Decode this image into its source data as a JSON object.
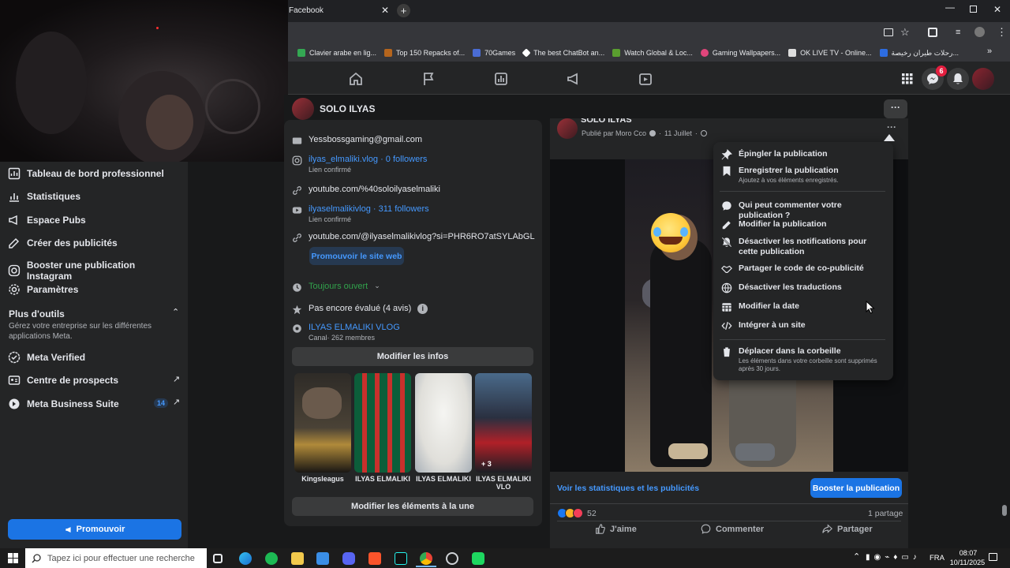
{
  "browser": {
    "tab_title": "Facebook",
    "bookmarks": [
      {
        "label": "Clavier arabe en lig...",
        "color": "#34a853"
      },
      {
        "label": "Top 150 Repacks of...",
        "color": "#b5651d"
      },
      {
        "label": "70Games",
        "color": "#4a6cd4"
      },
      {
        "label": "The best ChatBot an...",
        "color": "#ffffff"
      },
      {
        "label": "Watch Global & Loc...",
        "color": "#5a9e2f"
      },
      {
        "label": "Gaming Wallpapers...",
        "color": "#e0457b"
      },
      {
        "label": "OK LIVE TV - Online...",
        "color": "#dddddd"
      },
      {
        "label": "رحلات طيران رخيصة...",
        "color": "#2d6ce0"
      }
    ]
  },
  "header": {
    "notification_badge": "6"
  },
  "page": {
    "name": "SOLO ILYAS"
  },
  "sidebar": {
    "items": [
      {
        "label": "Tableau de bord professionnel",
        "icon": "dashboard-icon"
      },
      {
        "label": "Statistiques",
        "icon": "chart-icon"
      },
      {
        "label": "Espace Pubs",
        "icon": "megaphone-icon"
      },
      {
        "label": "Créer des publicités",
        "icon": "edit-icon"
      },
      {
        "label": "Booster une publication Instagram",
        "icon": "instagram-icon"
      },
      {
        "label": "Paramètres",
        "icon": "gear-icon"
      }
    ],
    "more_tools_title": "Plus d'outils",
    "more_tools_desc": "Gérez votre entreprise sur les différentes applications Meta.",
    "tools": [
      {
        "label": "Meta Verified",
        "icon": "verified-icon"
      },
      {
        "label": "Centre de prospects",
        "icon": "prospects-icon"
      },
      {
        "label": "Meta Business Suite",
        "icon": "business-suite-icon",
        "badge": "14"
      }
    ],
    "promote_label": "Promouvoir"
  },
  "intro": {
    "email": "Yessbossgaming@gmail.com",
    "instagram": "ilyas_elmaliki.vlog · 0 followers",
    "instagram_sub": "Lien confirmé",
    "youtube_url": "youtube.com/%40soloilyaselmaliki",
    "youtube_channel": "ilyaselmalikivlog · 311 followers",
    "youtube_sub": "Lien confirmé",
    "youtube_url2": "youtube.com/@ilyaselmalikivlog?si=PHR6RO7atSYLAbGL",
    "promote_site": "Promouvoir le site web",
    "hours": "Toujours ouvert",
    "rating": "Pas encore évalué (4 avis)",
    "channel_name": "ILYAS ELMALIKI VLOG",
    "channel_sub": "Canal· 262 membres",
    "edit_info": "Modifier les infos",
    "featured": [
      {
        "label": "Kingsleagus"
      },
      {
        "label": "ILYAS ELMALIKI"
      },
      {
        "label": "ILYAS ELMALIKI"
      },
      {
        "label": "ILYAS ELMALIKI VLO",
        "overlay": "+ 3"
      }
    ],
    "edit_featured": "Modifier les éléments à la une"
  },
  "post": {
    "author_partial": "SOLO ILYAS",
    "meta": "Publié par Moro Cco",
    "date": "11 Juillet",
    "stats_link": "Voir les statistiques et les publicités",
    "boost_label": "Booster la publication",
    "reactions_count": "52",
    "shares": "1 partage",
    "like_label": "J'aime",
    "comment_label": "Commenter",
    "share_label": "Partager"
  },
  "menu": {
    "items": [
      {
        "label": "Épingler la publication",
        "icon": "pin-icon"
      },
      {
        "label": "Enregistrer la publication",
        "sub": "Ajoutez à vos éléments enregistrés.",
        "icon": "bookmark-icon"
      },
      {
        "label": "Qui peut commenter votre publication ?",
        "icon": "comment-icon"
      },
      {
        "label": "Modifier la publication",
        "icon": "pencil-icon"
      },
      {
        "label": "Désactiver les notifications pour cette publication",
        "icon": "bell-off-icon"
      },
      {
        "label": "Partager le code de co-publicité",
        "icon": "handshake-icon"
      },
      {
        "label": "Désactiver les traductions",
        "icon": "globe-icon"
      },
      {
        "label": "Modifier la date",
        "icon": "calendar-icon"
      },
      {
        "label": "Intégrer à un site",
        "icon": "code-icon"
      },
      {
        "label": "Déplacer dans la corbeille",
        "sub": "Les éléments dans votre corbeille sont supprimés après 30 jours.",
        "icon": "trash-icon"
      }
    ]
  },
  "taskbar": {
    "search_placeholder": "Tapez ici pour effectuer une recherche",
    "lang": "FRA",
    "time": "08:07",
    "date": "10/11/2025"
  }
}
